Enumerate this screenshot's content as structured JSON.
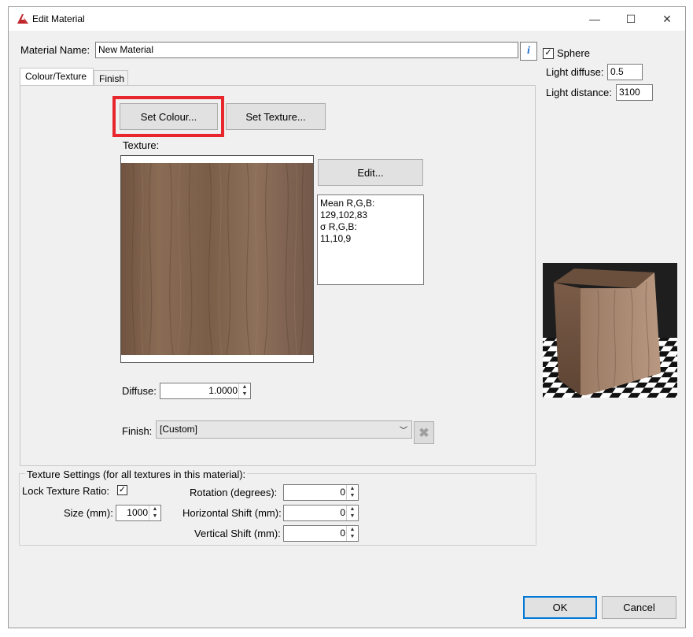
{
  "window": {
    "title": "Edit Material",
    "minimize": "—",
    "maximize": "☐",
    "close": "✕"
  },
  "material_name": {
    "label": "Material Name:",
    "value": "New Material",
    "info": "i"
  },
  "tabs": [
    {
      "label": "Colour/Texture",
      "active": true
    },
    {
      "label": "Finish",
      "active": false
    }
  ],
  "buttons": {
    "set_colour": "Set Colour...",
    "set_texture": "Set Texture...",
    "edit": "Edit...",
    "ok": "OK",
    "cancel": "Cancel"
  },
  "texture": {
    "label": "Texture:",
    "stats": [
      "Mean R,G,B:",
      "129,102,83",
      "σ R,G,B:",
      "11,10,9"
    ]
  },
  "diffuse": {
    "label": "Diffuse:",
    "value": "1.0000"
  },
  "finish": {
    "label": "Finish:",
    "value": "[Custom]"
  },
  "texture_settings": {
    "title": "Texture Settings (for all textures in this material):",
    "lock_ratio_label": "Lock Texture Ratio:",
    "lock_ratio_checked": true,
    "size_label": "Size (mm):",
    "size_value": "1000",
    "rotation_label": "Rotation (degrees):",
    "rotation_value": "0",
    "hshift_label": "Horizontal Shift (mm):",
    "hshift_value": "0",
    "vshift_label": "Vertical Shift (mm):",
    "vshift_value": "0"
  },
  "preview": {
    "sphere_label": "Sphere",
    "sphere_checked": true,
    "light_diffuse_label": "Light diffuse:",
    "light_diffuse_value": "0.5",
    "light_distance_label": "Light distance:",
    "light_distance_value": "3100"
  },
  "colors": {
    "highlight": "#e8262d",
    "wood": "#81664f"
  }
}
